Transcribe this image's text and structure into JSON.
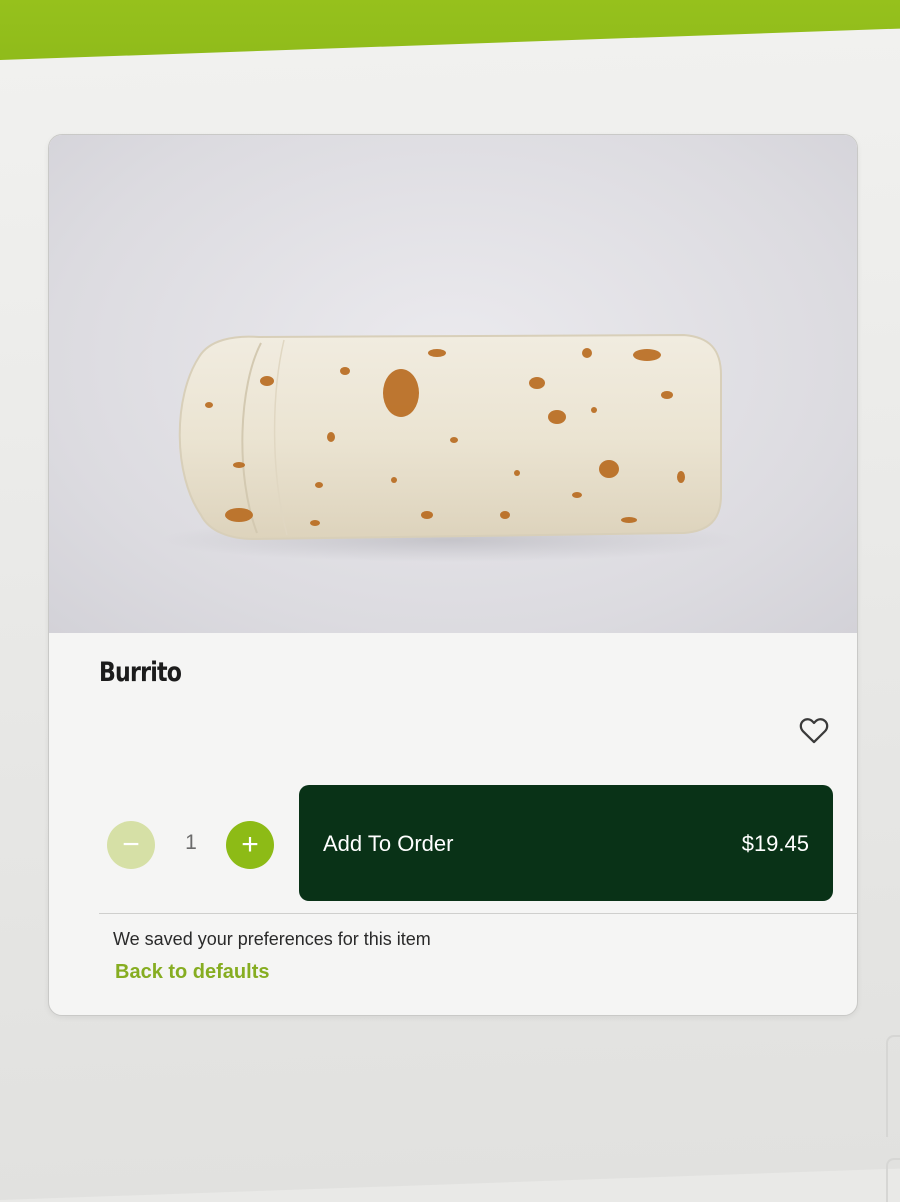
{
  "product": {
    "name": "Burrito",
    "image_alt": "burrito-photo",
    "favorite_icon": "heart-outline-icon"
  },
  "stepper": {
    "minus_label": "−",
    "quantity": "1",
    "plus_label": "+"
  },
  "order_button": {
    "label": "Add To Order",
    "price": "$19.45"
  },
  "preferences": {
    "message": "We saved your preferences for this item",
    "reset_link": "Back to defaults"
  },
  "colors": {
    "header_green": "#96c11c",
    "button_dark_green": "#093217",
    "accent_green": "#8dbb16",
    "link_green": "#86ad21"
  }
}
